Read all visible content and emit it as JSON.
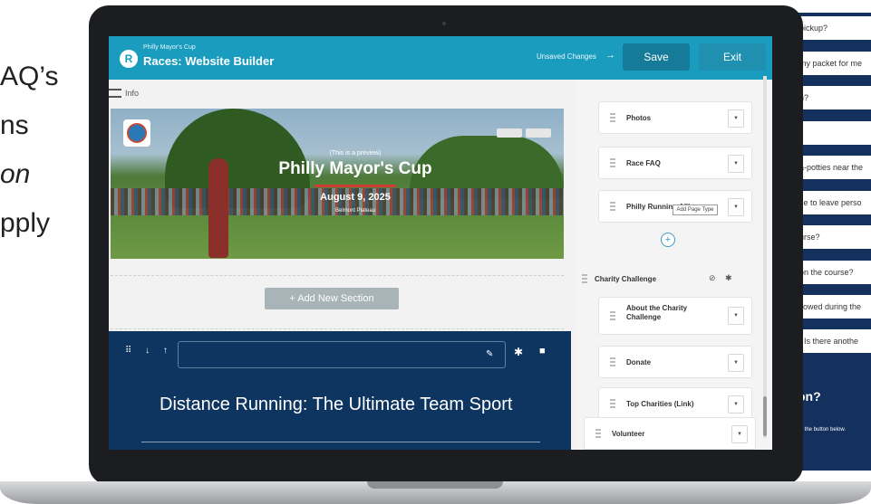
{
  "background": {
    "left_text": [
      "AQ’s",
      "ns",
      "on",
      "pply"
    ],
    "faq_rows": [
      "pickup?",
      "my packet for me",
      "n?",
      "",
      "a-potties near the",
      "ce to leave perso",
      "urse?",
      "on the course?",
      "llowed during the",
      ". Is there anothe"
    ],
    "faq_heading": "on?",
    "faq_sub": "ck the button below."
  },
  "header": {
    "logo_letter": "R",
    "subtitle": "Philly Mayor's Cup",
    "title": "Races: Website Builder",
    "unsaved_label": "Unsaved Changes",
    "arrow": "→",
    "save_label": "Save",
    "exit_label": "Exit"
  },
  "preview": {
    "info_label": "Info",
    "hero": {
      "preview_note": "(This is a preview)",
      "title": "Philly Mayor's Cup",
      "date": "August 9, 2025",
      "venue": "Belmont Plateau"
    },
    "add_section_label": "+  Add New Section",
    "dark_section": {
      "move_icons": "⠿ ↓ ↑",
      "heading": "Distance Running: The Ultimate Team Sport"
    }
  },
  "sidebar": {
    "cards_top": [
      {
        "label": "Photos"
      },
      {
        "label": "Race FAQ"
      },
      {
        "label": "Philly Running Alliance"
      }
    ],
    "add_page_type_tooltip": "Add Page Type",
    "group_charity": "Charity Challenge",
    "cards_charity": [
      {
        "label": "About the Charity Challenge"
      },
      {
        "label": "Donate"
      },
      {
        "label": "Top Charities (Link)"
      }
    ],
    "group_volunteer": "Volunteer",
    "dropdown_glyph": "▼",
    "plus_glyph": "+"
  }
}
